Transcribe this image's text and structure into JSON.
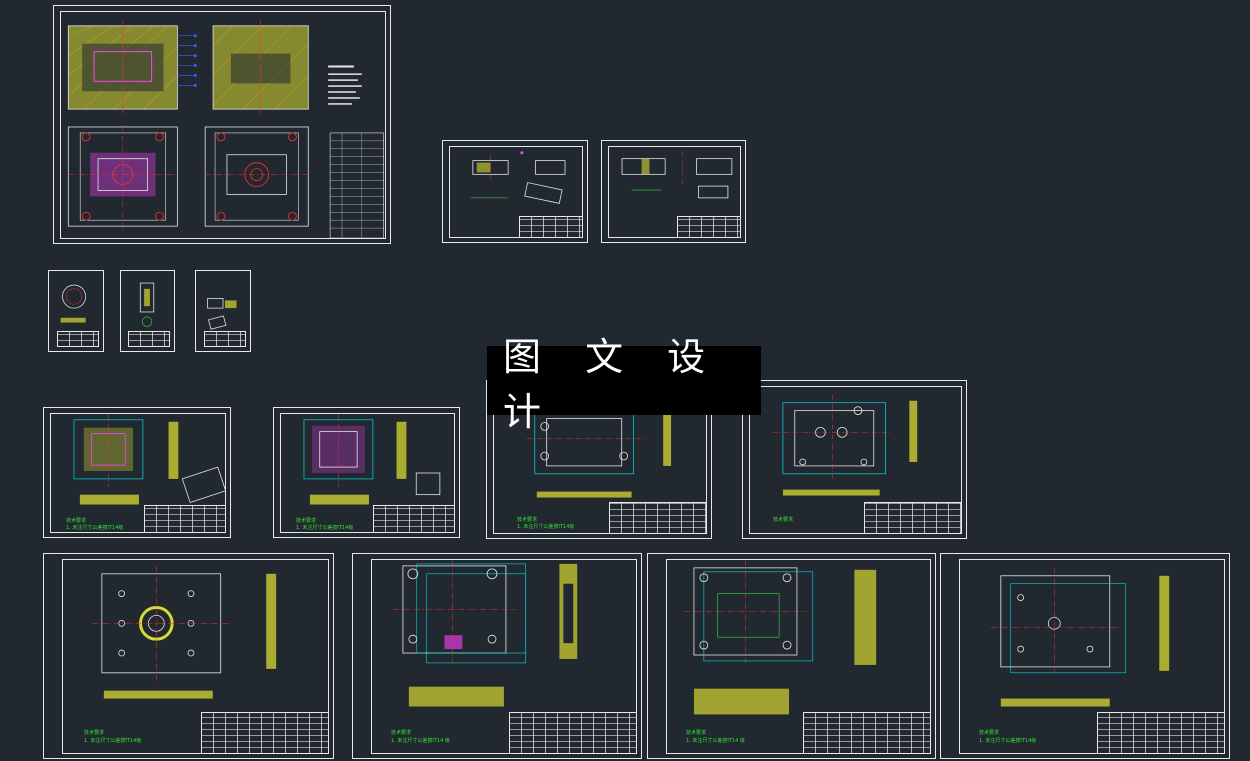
{
  "watermark": {
    "text": "图 文 设 计"
  },
  "sheets": [
    {
      "id": "assembly"
    },
    {
      "id": "part-a1"
    },
    {
      "id": "part-a2"
    },
    {
      "id": "small-1"
    },
    {
      "id": "small-2"
    },
    {
      "id": "small-3"
    },
    {
      "id": "mid-1",
      "note_title": "技术要求",
      "note_line": "1. 未注尺寸公差按IT14级"
    },
    {
      "id": "mid-2",
      "note_title": "技术要求",
      "note_line": "1. 未注尺寸公差按IT14级"
    },
    {
      "id": "mid-3",
      "note_title": "技术要求",
      "note_line": "1. 未注尺寸公差按IT14级"
    },
    {
      "id": "mid-4",
      "note_title": "技术要求",
      "note_line": ""
    },
    {
      "id": "bot-1",
      "note_title": "技术要求",
      "note_line": "1. 未注尺寸公差按IT14级"
    },
    {
      "id": "bot-2",
      "note_title": "技术要求",
      "note_line": "1. 未注尺寸公差按IT14 级"
    },
    {
      "id": "bot-3",
      "note_title": "技术要求",
      "note_line": "1. 未注尺寸公差按IT14 级"
    },
    {
      "id": "bot-4",
      "note_title": "技术要求",
      "note_line": "1. 未注尺寸公差按IT14级"
    }
  ],
  "colors": {
    "background": "#212830",
    "frame": "#e8e8e8",
    "section": "#d9d930",
    "hatch": "#f0e050",
    "outline": "#00e0e0",
    "center": "#ff3030",
    "dimension": "#34e334",
    "magenta": "#ff40ff",
    "blue": "#4060ff"
  }
}
